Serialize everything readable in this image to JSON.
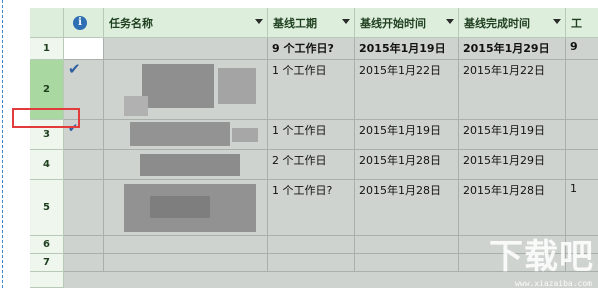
{
  "columns": {
    "task_name": "任务名称",
    "baseline_duration": "基线工期",
    "baseline_start": "基线开始时间",
    "baseline_finish": "基线完成时间",
    "last_col": "工"
  },
  "row_numbers": [
    "1",
    "2",
    "3",
    "4",
    "5",
    "6",
    "7"
  ],
  "rows": [
    {
      "duration": "9 个工作日?",
      "start": "2015年1月19日",
      "finish": "2015年1月29日",
      "extra": "9"
    },
    {
      "duration": "1 个工作日",
      "start": "2015年1月22日",
      "finish": "2015年1月22日"
    },
    {
      "duration": "1 个工作日",
      "start": "2015年1月19日",
      "finish": "2015年1月19日"
    },
    {
      "duration": "2 个工作日",
      "start": "2015年1月28日",
      "finish": "2015年1月29日"
    },
    {
      "duration": "1 个工作日?",
      "start": "2015年1月28日",
      "finish": "2015年1月28日",
      "extra": "1"
    }
  ],
  "watermark": {
    "main": "下载吧",
    "sub": "www.xiazaiba.com"
  },
  "colors": {
    "header_bg": "#ddeedd",
    "grid_bg": "#cfd3d0",
    "selected_row": "#a9d8a0",
    "highlight_box": "#e33b3b",
    "check": "#2e5f9e"
  }
}
